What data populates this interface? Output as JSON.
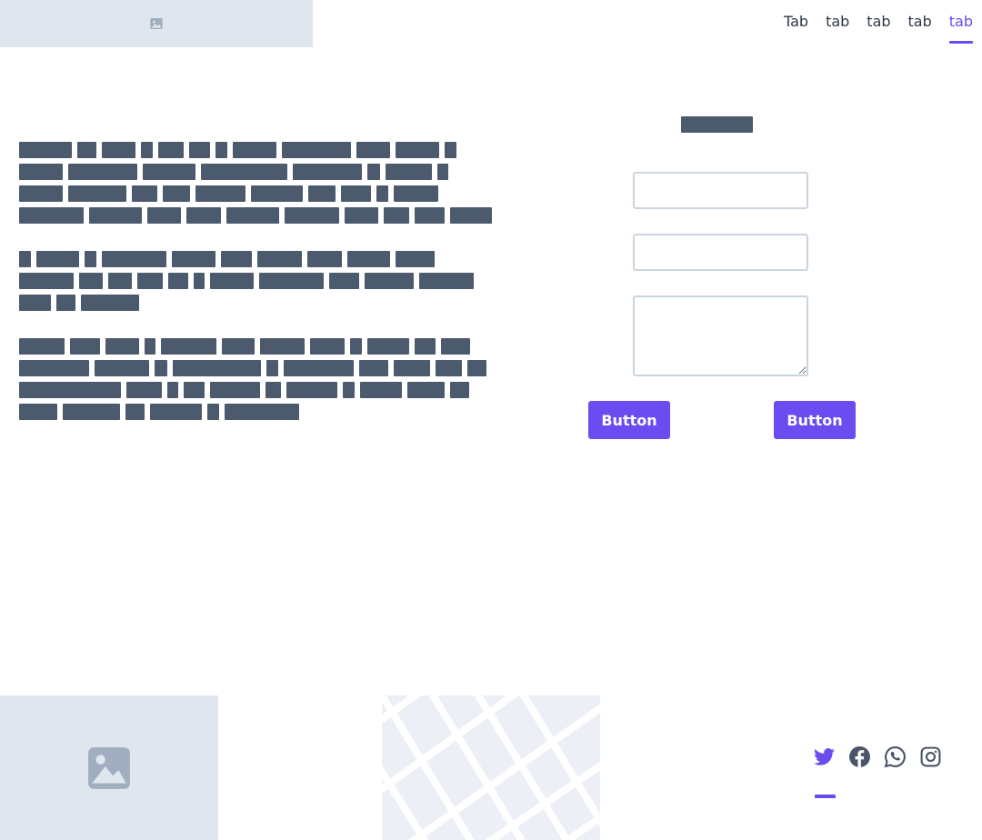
{
  "header": {
    "logo_icon": "image-placeholder-icon",
    "tabs": [
      {
        "label": "Tab",
        "active": false
      },
      {
        "label": "tab",
        "active": false
      },
      {
        "label": "tab",
        "active": false
      },
      {
        "label": "tab",
        "active": false
      },
      {
        "label": "tab",
        "active": true
      }
    ]
  },
  "form": {
    "button_1_label": "Button",
    "button_2_label": "Button"
  },
  "footer": {
    "image_icon": "image-placeholder-icon",
    "social_icons": [
      "twitter-icon",
      "facebook-icon",
      "whatsapp-icon",
      "instagram-icon"
    ],
    "active_social": "twitter-icon"
  },
  "colors": {
    "accent": "#6b4cf0",
    "placeholder_bg": "#e0e6ee",
    "text_block": "#4b5a6c",
    "border": "#cbd5e0"
  }
}
